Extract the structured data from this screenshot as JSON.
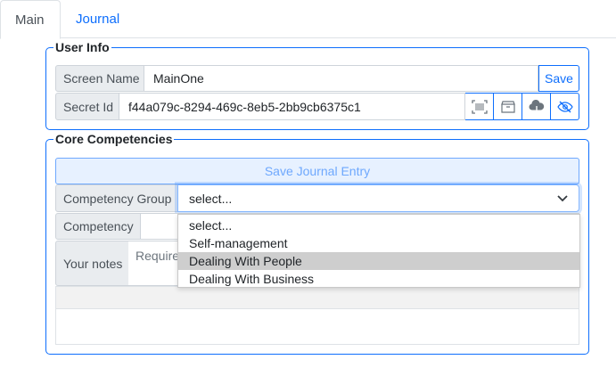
{
  "tabs": [
    {
      "label": "Main"
    },
    {
      "label": "Journal"
    }
  ],
  "user_info": {
    "legend": "User Info",
    "screen_name_label": "Screen Name",
    "screen_name_value": "MainOne",
    "save_label": "Save",
    "secret_id_label": "Secret Id",
    "secret_id_value": "f44a079c-8294-469c-8eb5-2bb9cb6375c1",
    "icons": [
      "barcode-scan-icon",
      "save-box-icon",
      "cloud-download-icon",
      "eye-slash-icon"
    ]
  },
  "core": {
    "legend": "Core Competencies",
    "save_journal_label": "Save Journal Entry",
    "competency_group_label": "Competency Group",
    "competency_group_value": "select...",
    "competency_label": "Competency",
    "notes_label": "Your notes",
    "notes_placeholder": "Require",
    "dropdown_options": [
      "select...",
      "Self-management",
      "Dealing With People",
      "Dealing With Business"
    ],
    "highlighted_option": "Dealing With People"
  },
  "colors": {
    "accent": "#0d6efd",
    "addon_bg": "#e9ecef",
    "highlight": "#cecece"
  }
}
